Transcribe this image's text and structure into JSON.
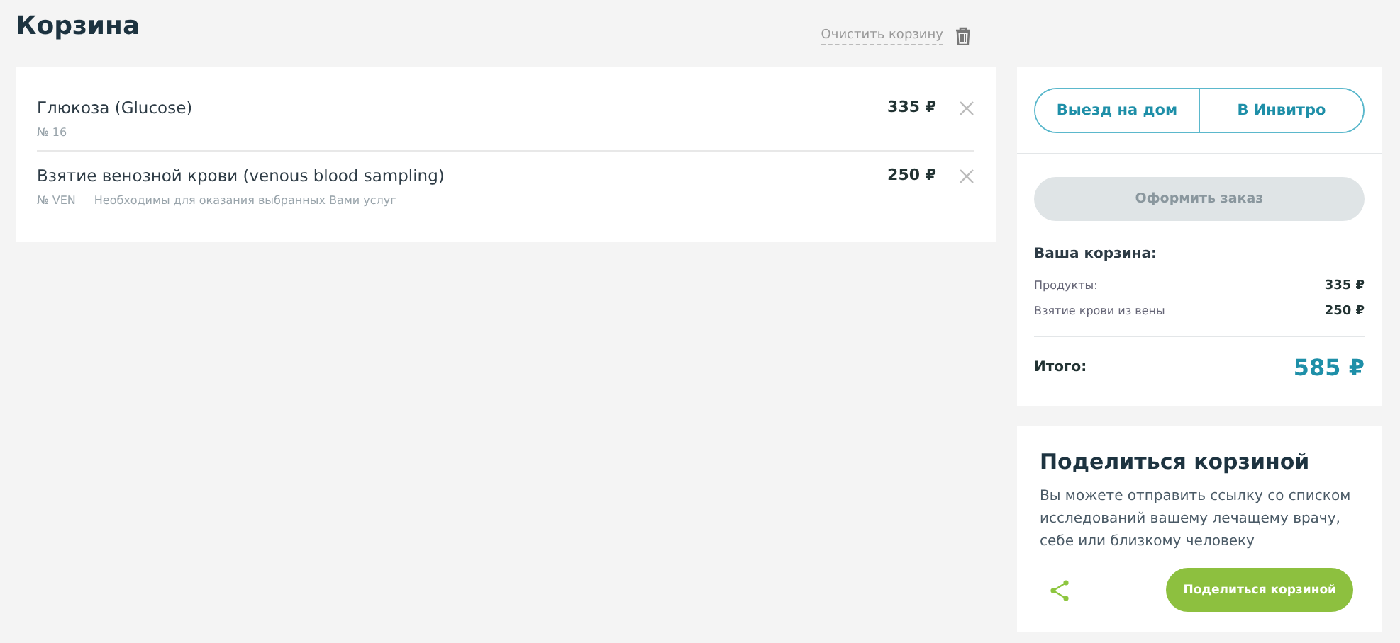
{
  "page_title": "Корзина",
  "clear_cart": {
    "label": "Очистить корзину"
  },
  "items": [
    {
      "name": "Глюкоза (Glucose)",
      "code": "№ 16",
      "price": "335 ₽"
    },
    {
      "name": "Взятие венозной крови (venous blood sampling)",
      "code": "№ VEN",
      "note": "Необходимы для оказания выбранных Вами услуг",
      "price": "250 ₽"
    }
  ],
  "delivery_options": [
    {
      "label": "Выезд на дом",
      "selected": false
    },
    {
      "label": "В Инвитро",
      "selected": false
    }
  ],
  "order_button": {
    "label": "Оформить заказ",
    "disabled": true
  },
  "summary": {
    "title": "Ваша корзина:",
    "lines": [
      {
        "label": "Продукты:",
        "value": "335 ₽"
      },
      {
        "label": "Взятие крови из вены",
        "value": "250 ₽"
      }
    ],
    "total_label": "Итого:",
    "total": "585 ₽"
  },
  "share": {
    "title": "Поделиться корзиной",
    "text": "Вы можете отправить ссылку со списком исследований вашему лечащему врачу, себе или близкому человеку",
    "button": "Поделиться корзиной"
  }
}
